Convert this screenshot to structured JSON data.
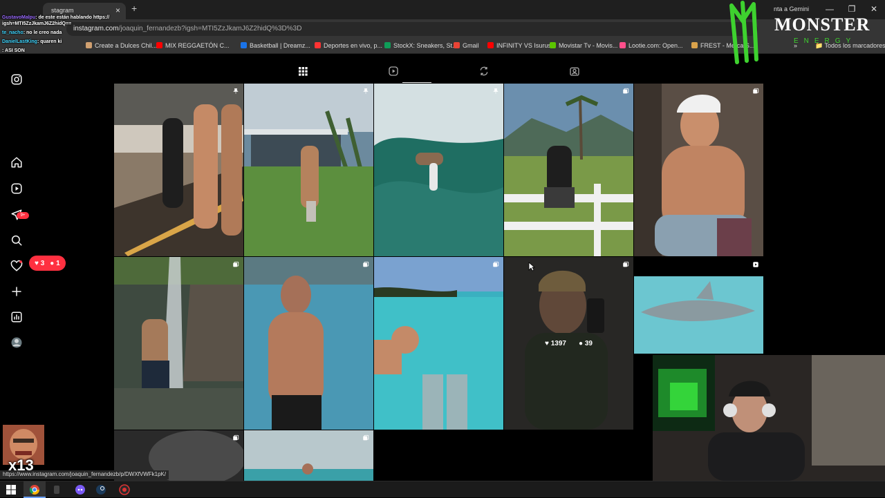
{
  "browser": {
    "tab_title": "stagram",
    "gemini_label": "nta a Gemini",
    "url_domain": "instagram.com",
    "url_path": "/joaquin_fernandezb?igsh=MTI5ZzJkamJ6Z2hidQ%3D%3D",
    "bookmarks": [
      {
        "label": "Create a Dulces Chil...",
        "color": "#d0a070"
      },
      {
        "label": "MIX REGGAETÓN C...",
        "color": "#ff0000"
      },
      {
        "label": "Basketball | Dreamz...",
        "color": "#1a73e8"
      },
      {
        "label": "Deportes en vivo, p...",
        "color": "#ff3333"
      },
      {
        "label": "StockX: Sneakers, St...",
        "color": "#0f9d58"
      },
      {
        "label": "Gmail",
        "color": "#ea4335"
      },
      {
        "label": "INFINITY VS Isurus",
        "color": "#ff0000"
      },
      {
        "label": "Movistar Tv - Movis...",
        "color": "#5bc500"
      },
      {
        "label": "Lootie.com: Open...",
        "color": "#ff4f8b"
      },
      {
        "label": "FREST - Merca S...",
        "color": "#d9a24b"
      }
    ],
    "all_bookmarks": "Todos los marcadores",
    "status_url": "https://www.instagram.com/joaquin_fernandezb/p/DWXfVWFk1pK/"
  },
  "chat": [
    {
      "user": "GustavoMalpu",
      "text": ": de este están hablando https://",
      "cls": "u1"
    },
    {
      "user": "",
      "text": "igsh=MTI5ZzJkamJ6Z2hidQ==",
      "cls": "u1"
    },
    {
      "user": "te_nacho",
      "text": ": no le creo nada",
      "cls": "u2"
    },
    {
      "user": "DanielLastKing",
      "text": ": quaren ki",
      "cls": "u2"
    },
    {
      "user": "",
      "text": ": ASI SON",
      "cls": "u3"
    }
  ],
  "monster": {
    "word": "MONSTER",
    "sub": "ENERGY"
  },
  "instagram": {
    "nav": [
      "instagram-icon",
      "home-icon",
      "reels-icon",
      "messages-icon",
      "search-icon",
      "notifications-icon",
      "create-icon",
      "insights-icon",
      "profile-avatar"
    ],
    "messages_badge": "9+",
    "likes_count": "3",
    "followers_count": "1",
    "tabs": [
      "posts-grid-tab",
      "reels-tab",
      "reposts-tab",
      "tagged-tab"
    ],
    "hover_stats": {
      "likes": "1397",
      "comments": "39"
    }
  },
  "emote": {
    "counter": "x13"
  },
  "colors": {
    "ig_red": "#ff3040",
    "bg": "#000000"
  }
}
